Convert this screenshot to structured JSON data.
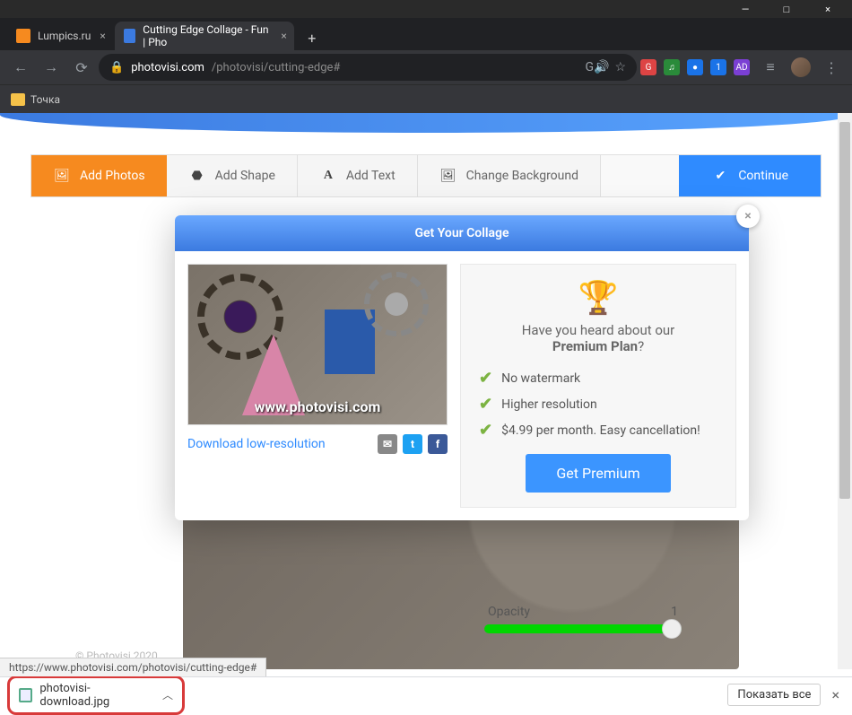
{
  "window": {
    "min": "—",
    "max": "□",
    "close": "×"
  },
  "tabs": {
    "t1": "Lumpics.ru",
    "t2": "Cutting Edge Collage - Fun | Pho",
    "plus": "+"
  },
  "nav": {
    "back": "←",
    "fwd": "→",
    "reload": "⟳"
  },
  "url": {
    "domain": "photovisi.com",
    "path": "/photovisi/cutting-edge#",
    "lock": "🔒"
  },
  "addr_actions": {
    "gt": "G🔊",
    "bm": "☆"
  },
  "ext": {
    "e1": "G",
    "e2": "♫",
    "e3": "●",
    "e4": "1",
    "e5": "AD",
    "reader": "≡"
  },
  "menu": "⋮",
  "bookmarks": {
    "b1": "Точка"
  },
  "toolbar": {
    "add_photos": "Add Photos",
    "add_shape": "Add Shape",
    "add_text": "Add Text",
    "change_bg": "Change Background",
    "continue": "Continue"
  },
  "icons": {
    "photos": "🖼",
    "shape": "⬣",
    "text": "A",
    "bg": "🖼",
    "check": "✔"
  },
  "slider": {
    "label": "Opacity",
    "value": "1"
  },
  "modal": {
    "title": "Get Your Collage",
    "watermark": "www.photovisi.com",
    "download_link": "Download low-resolution",
    "mail": "✉",
    "tw": "t",
    "fb": "f",
    "trophy": "🏆",
    "heard_1": "Have you heard about our",
    "heard_2": "Premium Plan",
    "q": "?",
    "f1": "No watermark",
    "f2": "Higher resolution",
    "f3": "$4.99 per month. Easy cancellation!",
    "get_premium": "Get Premium",
    "close": "×"
  },
  "status_url": "https://www.photovisi.com/photovisi/cutting-edge#",
  "copyright": "© Photovisi 2020",
  "downloads": {
    "file": "photovisi-download.jpg",
    "chev": "︿",
    "show_all": "Показать все",
    "close": "×"
  }
}
